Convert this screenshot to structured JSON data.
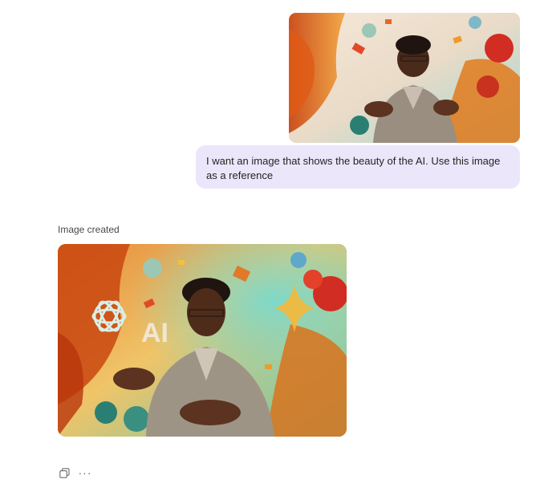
{
  "conversation": {
    "user_message": {
      "text": "I want an image that shows the beauty of the AI. Use this image as a reference"
    },
    "assistant_message": {
      "status_label": "Image created",
      "image_overlay_text": "AI"
    },
    "actions": {
      "more_label": "···"
    }
  },
  "colors": {
    "bubble_background": "#ece6fb",
    "text": "#242424",
    "muted_text": "#4a4a4a"
  }
}
